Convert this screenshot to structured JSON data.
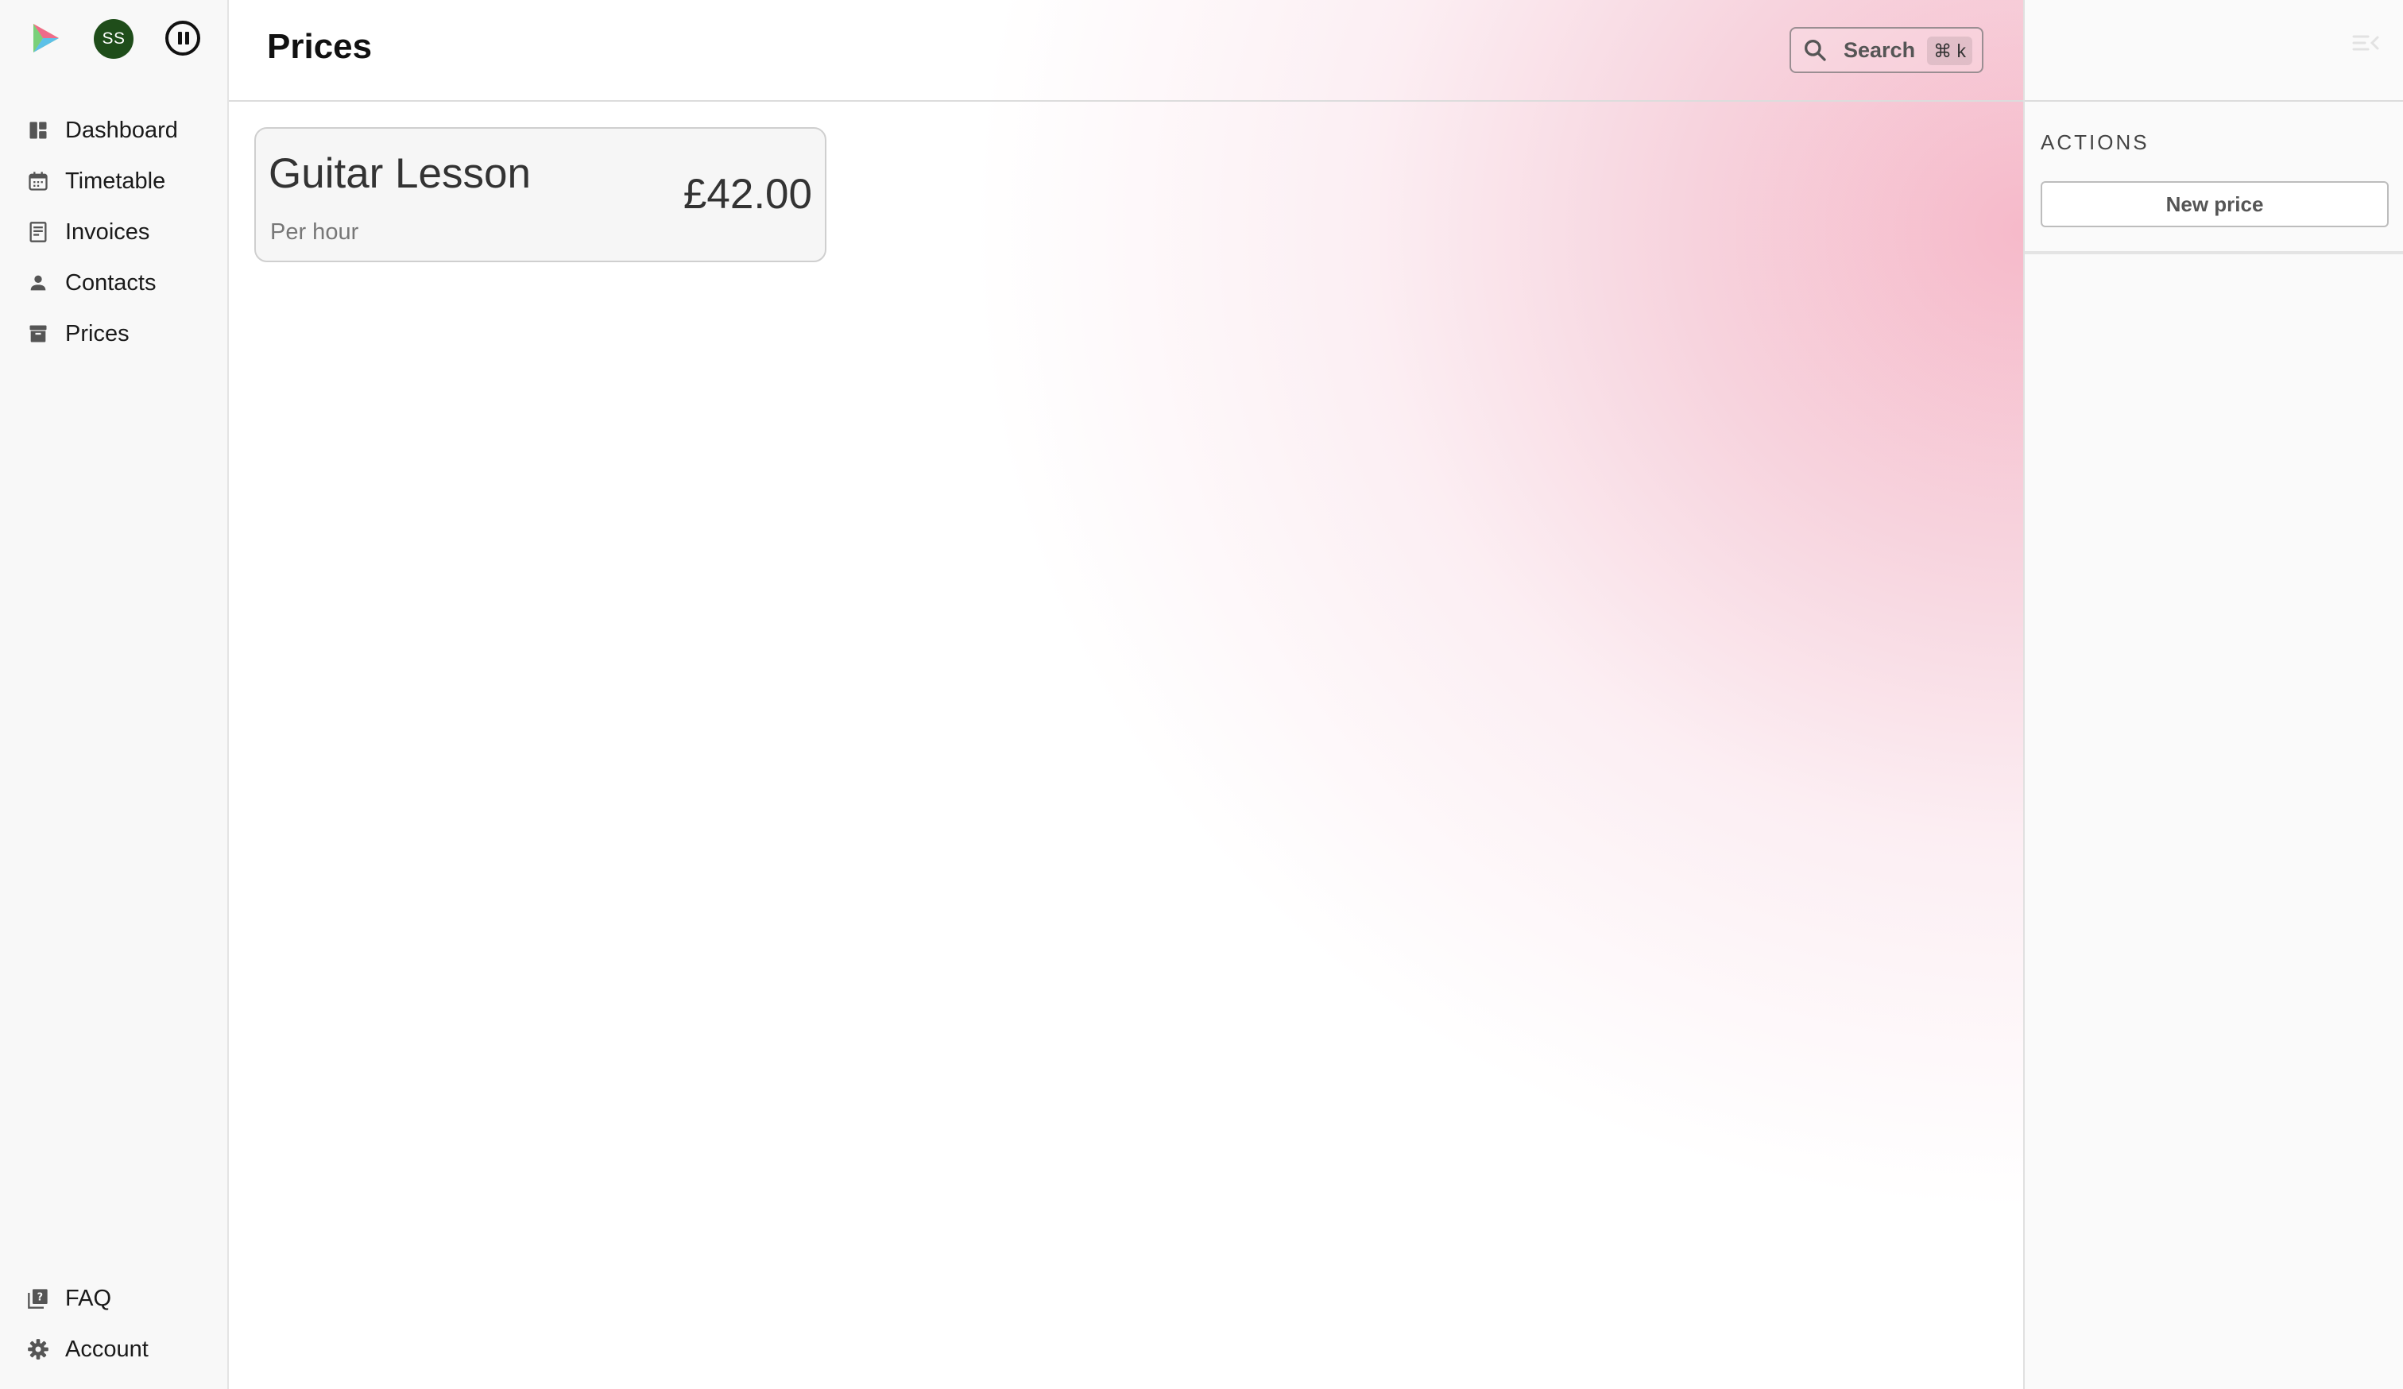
{
  "sidebar": {
    "avatar_initials": "SS",
    "nav_items": [
      {
        "label": "Dashboard",
        "icon": "dashboard-icon"
      },
      {
        "label": "Timetable",
        "icon": "calendar-icon"
      },
      {
        "label": "Invoices",
        "icon": "invoice-icon"
      },
      {
        "label": "Contacts",
        "icon": "person-icon"
      },
      {
        "label": "Prices",
        "icon": "archive-icon"
      }
    ],
    "bottom_items": [
      {
        "label": "FAQ",
        "icon": "faq-icon"
      },
      {
        "label": "Account",
        "icon": "gear-icon"
      }
    ]
  },
  "header": {
    "title": "Prices",
    "search_placeholder": "Search",
    "search_shortcut": "⌘ k"
  },
  "prices": [
    {
      "name": "Guitar Lesson",
      "unit": "Per hour",
      "amount": "£42.00"
    }
  ],
  "actions_panel": {
    "heading": "ACTIONS",
    "new_price_label": "New price"
  },
  "colors": {
    "avatar": "#1f4d1a",
    "accent_gradient": "#f6b6c7",
    "sidebar_bg": "#f8f8f8"
  }
}
